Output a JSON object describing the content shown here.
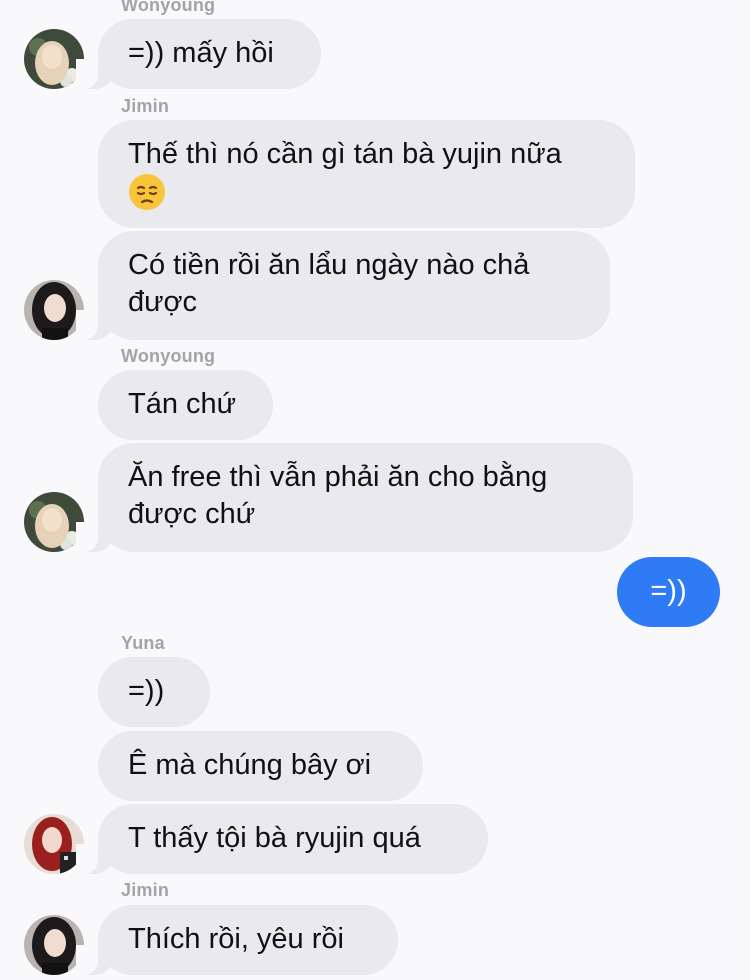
{
  "messages": [
    {
      "sender": "Wonyoung",
      "text": "=)) mấy hồi"
    },
    {
      "sender": "Jimin",
      "text": "Thế thì nó cần gì tán bà yujin nữa",
      "emoji": "pensive-face"
    },
    {
      "text": "Có tiền rồi ăn lẩu ngày nào chả được"
    },
    {
      "sender": "Wonyoung",
      "text": "Tán chứ"
    },
    {
      "text": "Ăn free thì vẫn phải ăn cho bằng được chứ"
    },
    {
      "outgoing": true,
      "text": "=))"
    },
    {
      "sender": "Yuna",
      "text": "=))"
    },
    {
      "text": "Ê mà chúng bây ơi"
    },
    {
      "text": "T thấy tội bà ryujin quá"
    },
    {
      "sender": "Jimin",
      "text": "Thích rồi, yêu rồi"
    }
  ],
  "colors": {
    "incoming_bubble": "#e9e9ee",
    "outgoing_bubble": "#2f7bf5",
    "sender_label": "#a3a3a8",
    "background": "#f9f9fb"
  }
}
